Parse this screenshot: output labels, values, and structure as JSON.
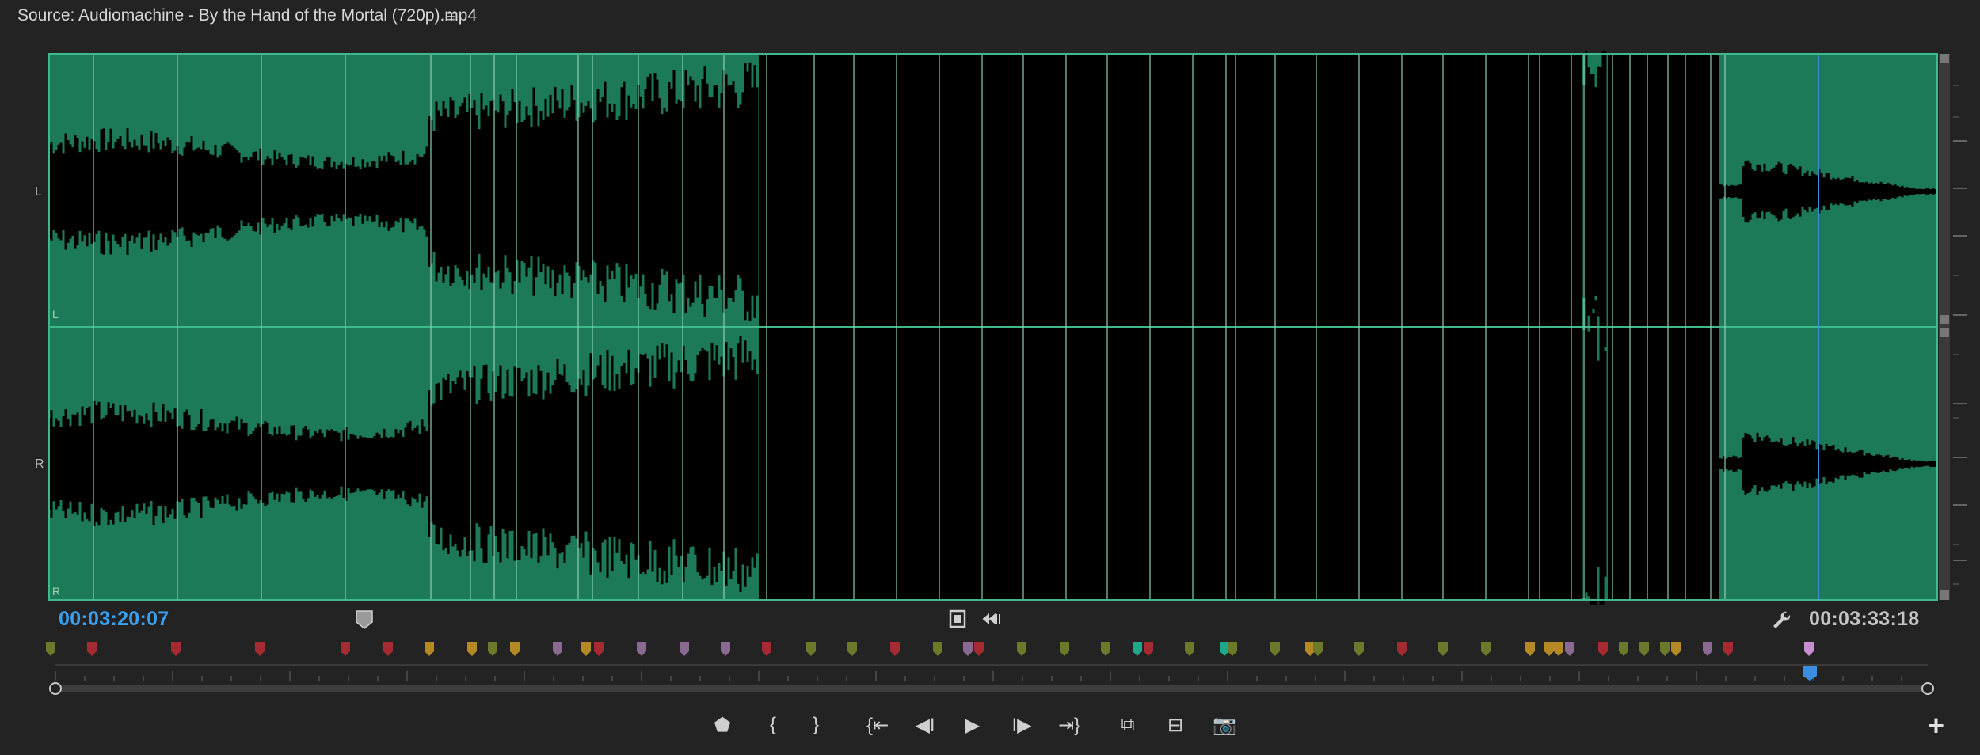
{
  "title": "Source: Audiomachine - By the Hand of the Mortal (720p).mp4",
  "title_menu_icon": "hamburger-menu-icon",
  "channels": {
    "left_label": "L",
    "right_label": "R",
    "left_inner_label": "L",
    "right_inner_label": "R"
  },
  "timecodes": {
    "current": "00:03:20:07",
    "duration": "00:03:33:18"
  },
  "icons": {
    "playhead_handle": "playhead-handle-icon",
    "drag_video": "drag-video-only-icon",
    "drag_audio": "drag-audio-only-icon",
    "settings": "wrench-icon",
    "add": "plus-icon"
  },
  "colors": {
    "panel_bg": "#232323",
    "waveform_fill": "#1d7a58",
    "waveform_bg": "#000000",
    "timecode_accent": "#3aa0f0",
    "playhead": "#3a8fe0",
    "marker_olive": "#6b7a2a",
    "marker_red": "#a52a32",
    "marker_orange": "#b58a25",
    "marker_purple": "#8a6a93",
    "marker_teal": "#1ea88a",
    "marker_lavender": "#c58fd0"
  },
  "transport_buttons": [
    {
      "name": "add-marker-button",
      "glyph": "⬟"
    },
    {
      "name": "mark-in-button",
      "glyph": "{"
    },
    {
      "name": "mark-out-button",
      "glyph": "}"
    },
    {
      "name": "go-to-in-button",
      "glyph": "{⇤"
    },
    {
      "name": "step-back-button",
      "glyph": "◀I"
    },
    {
      "name": "play-button",
      "glyph": "▶"
    },
    {
      "name": "step-forward-button",
      "glyph": "I▶"
    },
    {
      "name": "go-to-out-button",
      "glyph": "⇥}"
    },
    {
      "name": "insert-button",
      "glyph": "⧉"
    },
    {
      "name": "overwrite-button",
      "glyph": "⊟"
    },
    {
      "name": "export-frame-button",
      "glyph": "📷"
    }
  ]
}
